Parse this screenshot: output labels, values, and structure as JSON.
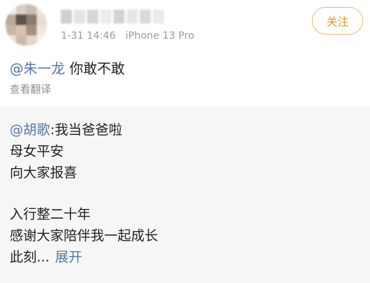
{
  "post": {
    "author_time": "1-31 14:46",
    "author_device": "iPhone 13 Pro",
    "follow_label": "关注",
    "mention": "@朱一龙",
    "text": " 你敢不敢",
    "translate_label": "查看翻译"
  },
  "quote": {
    "mention": "@胡歌",
    "lines": [
      ":我当爸爸啦",
      "母女平安",
      "向大家报喜",
      "入行整二十年",
      "感谢大家陪伴我一起成长",
      "此刻..."
    ],
    "expand_label": "展开"
  },
  "colors": {
    "link": "#5377a6",
    "follow_border": "#e9b764",
    "follow_text": "#e09a26",
    "quote_bg": "#f6f6f6",
    "meta_text": "#9a9a9a"
  },
  "icons": {
    "avatar": "blurred-avatar-image",
    "username": "blurred-username"
  }
}
